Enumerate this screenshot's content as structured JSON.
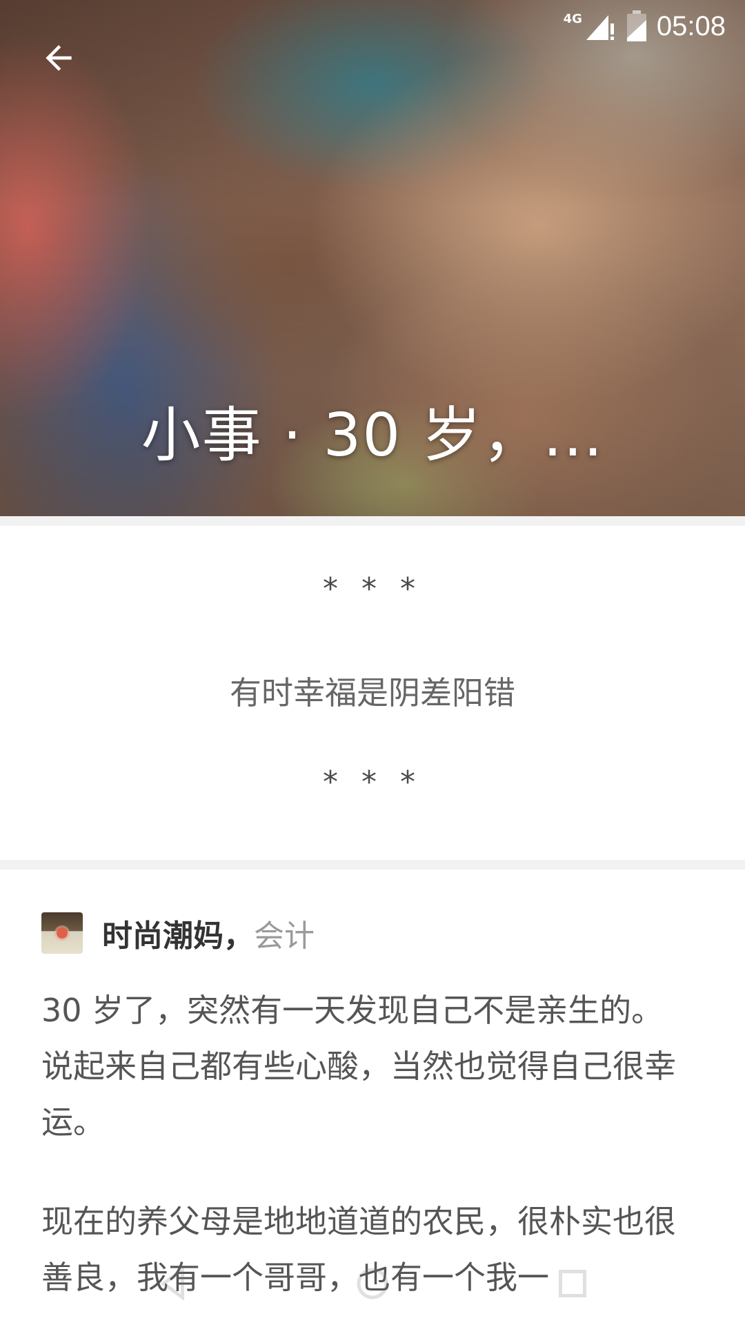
{
  "status_bar": {
    "network": "4G",
    "time": "05:08"
  },
  "header": {
    "back_icon": "arrow-left-icon",
    "title": "小事 · 30 岁，..."
  },
  "quote": {
    "stars_top": "* * *",
    "text": "有时幸福是阴差阳错",
    "stars_bottom": "* * *"
  },
  "answer": {
    "author_name": "时尚潮妈",
    "separator": "，",
    "author_role": "会计",
    "paragraphs": [
      "30 岁了，突然有一天发现自己不是亲生的。说起来自己都有些心酸，当然也觉得自己很幸运。",
      "现在的养父母是地地道道的农民，很朴实也很善良，我有一个哥哥，也有一个我一"
    ]
  },
  "nav_bar": {
    "icons": [
      "back-triangle-icon",
      "home-circle-icon",
      "recents-square-icon"
    ]
  }
}
